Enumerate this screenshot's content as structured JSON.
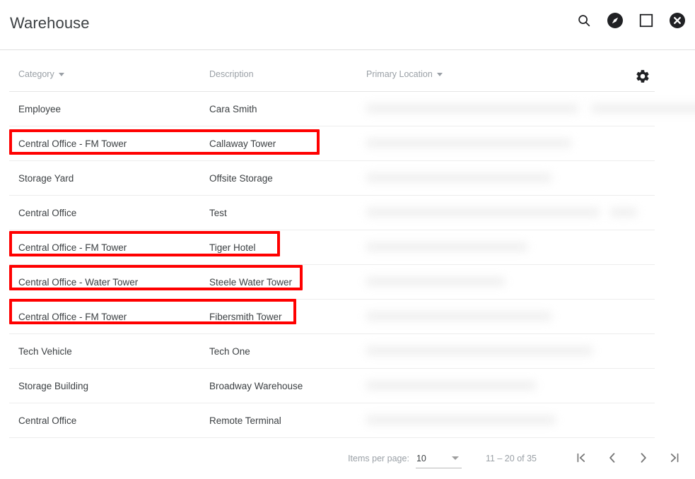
{
  "titlebar": {
    "title": "Warehouse",
    "actions": [
      {
        "name": "search-icon",
        "label": "Search"
      },
      {
        "name": "compass-icon",
        "label": "Explore"
      },
      {
        "name": "maximize-icon",
        "label": "Maximize"
      },
      {
        "name": "close-icon",
        "label": "Close"
      }
    ]
  },
  "table": {
    "columns": [
      {
        "label": "Category",
        "sortable": true
      },
      {
        "label": "Description",
        "sortable": false
      },
      {
        "label": "Primary Location",
        "sortable": true
      }
    ],
    "settings_icon": "gear-icon",
    "rows": [
      {
        "category": "Employee",
        "description": "Cara Smith",
        "location": "",
        "highlighted": false
      },
      {
        "category": "Central Office - FM Tower",
        "description": "Callaway Tower",
        "location": "",
        "highlighted": true,
        "highlight_width": 439
      },
      {
        "category": "Storage Yard",
        "description": "Offsite Storage",
        "location": "",
        "highlighted": false
      },
      {
        "category": "Central Office",
        "description": "Test",
        "location": "",
        "highlighted": false
      },
      {
        "category": "Central Office - FM Tower",
        "description": "Tiger Hotel",
        "location": "",
        "highlighted": true,
        "highlight_width": 383
      },
      {
        "category": "Central Office - Water Tower",
        "description": "Steele Water Tower",
        "location": "",
        "highlighted": true,
        "highlight_width": 415
      },
      {
        "category": "Central Office - FM Tower",
        "description": "Fibersmith Tower",
        "location": "",
        "highlighted": true,
        "highlight_width": 406
      },
      {
        "category": "Tech Vehicle",
        "description": "Tech One",
        "location": "",
        "highlighted": false
      },
      {
        "category": "Storage Building",
        "description": "Broadway Warehouse",
        "location": "",
        "highlighted": false
      },
      {
        "category": "Central Office",
        "description": "Remote Terminal",
        "location": "",
        "highlighted": false
      }
    ]
  },
  "paginator": {
    "items_per_page_label": "Items per page:",
    "items_per_page_value": "10",
    "range_label": "11 – 20 of 35",
    "first_page_label": "First page",
    "prev_page_label": "Previous page",
    "next_page_label": "Next page",
    "last_page_label": "Last page"
  },
  "colors": {
    "highlight": "#ff0000",
    "text": "#3c4043",
    "muted": "#9aa0a6",
    "divider": "#e0e0e0"
  }
}
